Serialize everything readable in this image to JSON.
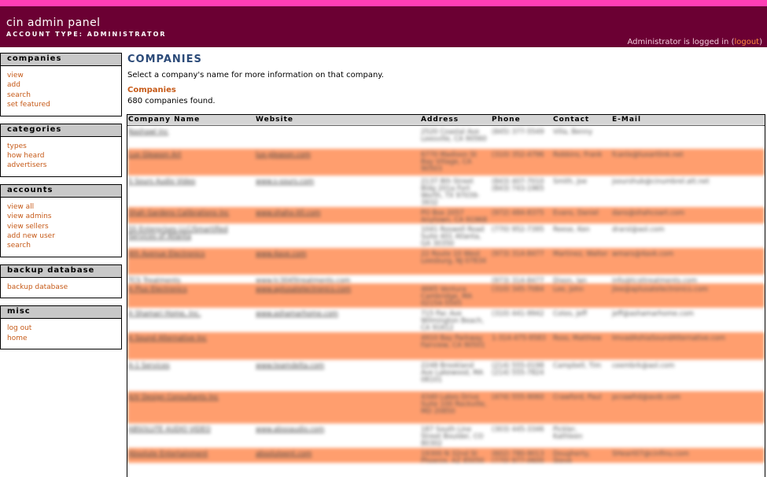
{
  "header": {
    "title": "cin admin panel",
    "account_type": "ACCOUNT TYPE: ADMINISTRATOR",
    "login_prefix": "Administrator is logged in (",
    "logout_label": "logout",
    "login_suffix": ")"
  },
  "sidebar": {
    "sections": [
      {
        "title": "companies",
        "items": [
          "view",
          "add",
          "search",
          "set featured"
        ]
      },
      {
        "title": "categories",
        "items": [
          "types",
          "how heard",
          "advertisers"
        ]
      },
      {
        "title": "accounts",
        "items": [
          "view all",
          "view admins",
          "view sellers",
          "add new user",
          "search"
        ]
      },
      {
        "title": "backup database",
        "items": [
          "backup database"
        ]
      },
      {
        "title": "misc",
        "items": [
          "log out",
          "home"
        ]
      }
    ]
  },
  "main": {
    "title": "COMPANIES",
    "intro": "Select a company's name for more information on that company.",
    "section_label": "Companies",
    "count_text": "680 companies found."
  },
  "table": {
    "columns": [
      "Company Name",
      "Website",
      "Address",
      "Phone",
      "Contact",
      "E-Mail"
    ],
    "rows": [
      [
        "Nashawl Inc",
        "",
        "2520 Coastal Ave Leesville, CA 90560",
        "(845) 377-5549",
        "Villa, Benny",
        ""
      ],
      [
        "Lux Gleason Art",
        "lux-gleason.com",
        "6770 Madison St Bay Village, CA 90503",
        "(310) 352-4796",
        "Robbins, Frank",
        "fcanlx@luxartlink.net"
      ],
      [
        "S Sours Audio Video",
        "www.s-sours.com",
        "2137 8th Street Bldg 201a Fort Worth, TX 97039-3932",
        "(843) 407-7010 (843) 743-1965",
        "Smith, Joe",
        "jsourshub@cinumbrel.att.net"
      ],
      [
        "Shah Gardens Calibrations Inc",
        "www.shahx-itll.com",
        "PO Box 2057 Anytown, CA 91968",
        "(972) 484-8375",
        "Evans, Daniel",
        "dans@shahcoart.com"
      ],
      [
        "SS Enterprises LLC/Smartified Services of Atlanta",
        "",
        "1041 Roswell Road Suite 401 Atlanta, GA 30350",
        "(770) 952-7395",
        "Reese, Ken",
        "drarsl@aol.com"
      ],
      [
        "4th Avenue Electronics",
        "www.4ave.com",
        "22 Route 10 West Leesburg, NJ 07834",
        "(973) 314-8477",
        "Martinez, Walter",
        "wmars@4avk.com"
      ],
      [
        "TCS Treatments",
        "www.tc3045treatments.com",
        "",
        "(973) 314-8477",
        "Dixon, Ian",
        "info@tcsttreatments.com"
      ],
      [
        "A Plus Electronics",
        "www.aplusatelectronics.com",
        "4665 Ventura Cambridge, MA 02154-5545",
        "(310) 345-7084",
        "Lee, John",
        "jlee@aplusatelectronics.com"
      ],
      [
        "A Shamari Home, Inc.",
        "www.ashamarhome.com",
        "715 Pac Ave Wilmington Beach, CA 91612",
        "(310) 441-9942",
        "Cotes, Jeff",
        "jeff@ashamarhome.com"
      ],
      [
        "A Sound Alternative Inc",
        "",
        "4910 Bay Parkway Fairview, CA 90501",
        "1-314-475-9583",
        "Ross, Matthew",
        "ImvadAshiaSoundAlternative.com"
      ],
      [
        "A-1 Services",
        "www.teamdelta.com",
        "2248 Brookland Ave Lakewood, MA 08101",
        "(214) 555-0198 (214) 555-7824",
        "Campbell, Tim",
        "ceembrk@aol.com"
      ],
      [
        "A/V Design Consultants Inc",
        "",
        "4340 Lakes Drive Suite 100 Rockville, MD 20850",
        "(474) 555-9060",
        "Crawford, Paul",
        "pcrawfrd@avdc.com"
      ],
      [
        "ABSOLUTE AUDIO VIDEO",
        "www.absoaudio.com",
        "187 South Line Street Boulder, CO 80302",
        "(303) 445-3346",
        "Pickler, Kathleen",
        ""
      ],
      [
        "Absolute Entertainment",
        "absoluteent.com",
        "19300 N 32nd St Phoenix, AZ 85050",
        "(602) 780-9013 (770) 977-0600",
        "Dougherty, Steve",
        "SHeart07@cinfinu.com"
      ]
    ]
  }
}
